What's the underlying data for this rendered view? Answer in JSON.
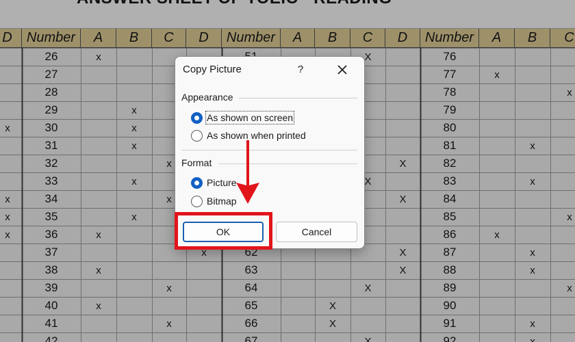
{
  "sheet": {
    "title": "ANSWER SHEET OF TOEIC - READING",
    "col_headers": [
      "D",
      "Number",
      "A",
      "B",
      "C",
      "D",
      "Number",
      "A",
      "B",
      "C",
      "D",
      "Number",
      "A",
      "B",
      "C"
    ],
    "rows": [
      [
        "",
        "26",
        "x",
        "",
        "",
        "",
        "51",
        "",
        "",
        "X",
        "",
        "76",
        "",
        "",
        ""
      ],
      [
        "",
        "27",
        "",
        "",
        "",
        "",
        "",
        "",
        "",
        "",
        "",
        "77",
        "x",
        "",
        ""
      ],
      [
        "",
        "28",
        "",
        "",
        "",
        "",
        "",
        "",
        "",
        "",
        "",
        "78",
        "",
        "",
        "x"
      ],
      [
        "",
        "29",
        "",
        "x",
        "",
        "",
        "",
        "",
        "",
        "",
        "",
        "79",
        "",
        "",
        ""
      ],
      [
        "x",
        "30",
        "",
        "x",
        "",
        "",
        "",
        "",
        "",
        "",
        "",
        "80",
        "",
        "",
        ""
      ],
      [
        "",
        "31",
        "",
        "x",
        "",
        "",
        "",
        "",
        "",
        "",
        "",
        "81",
        "",
        "x",
        ""
      ],
      [
        "",
        "32",
        "",
        "",
        "x",
        "",
        "",
        "",
        "",
        "",
        "X",
        "82",
        "",
        "",
        ""
      ],
      [
        "",
        "33",
        "",
        "x",
        "",
        "",
        "",
        "",
        "",
        "X",
        "",
        "83",
        "",
        "x",
        ""
      ],
      [
        "x",
        "34",
        "",
        "",
        "x",
        "",
        "",
        "",
        "",
        "",
        "X",
        "84",
        "",
        "",
        ""
      ],
      [
        "x",
        "35",
        "",
        "x",
        "",
        "",
        "",
        "",
        "",
        "",
        "",
        "85",
        "",
        "",
        "x"
      ],
      [
        "x",
        "36",
        "x",
        "",
        "",
        "",
        "",
        "",
        "",
        "",
        "",
        "86",
        "x",
        "",
        ""
      ],
      [
        "",
        "37",
        "",
        "",
        "",
        "x",
        "62",
        "",
        "",
        "",
        "X",
        "87",
        "",
        "x",
        ""
      ],
      [
        "",
        "38",
        "x",
        "",
        "",
        "",
        "63",
        "",
        "",
        "",
        "X",
        "88",
        "",
        "x",
        ""
      ],
      [
        "",
        "39",
        "",
        "",
        "x",
        "",
        "64",
        "",
        "",
        "X",
        "",
        "89",
        "",
        "",
        "x"
      ],
      [
        "",
        "40",
        "x",
        "",
        "",
        "",
        "65",
        "",
        "X",
        "",
        "",
        "90",
        "",
        "",
        ""
      ],
      [
        "",
        "41",
        "",
        "",
        "x",
        "",
        "66",
        "",
        "X",
        "",
        "",
        "91",
        "",
        "x",
        ""
      ],
      [
        "",
        "42",
        "",
        "",
        "",
        "",
        "67",
        "",
        "",
        "X",
        "",
        "92",
        "",
        "x",
        ""
      ]
    ]
  },
  "dialog": {
    "title": "Copy Picture",
    "help_label": "?",
    "appearance_label": "Appearance",
    "appearance_options": [
      "As shown on screen",
      "As shown when printed"
    ],
    "appearance_selected": 0,
    "format_label": "Format",
    "format_options": [
      "Picture",
      "Bitmap"
    ],
    "format_selected": 0,
    "ok_label": "OK",
    "cancel_label": "Cancel"
  },
  "colors": {
    "highlight": "#e2141b",
    "accent": "#1160c4",
    "header_fill": "#9e916a"
  },
  "icons": [
    "close-icon",
    "down-arrow-icon"
  ]
}
